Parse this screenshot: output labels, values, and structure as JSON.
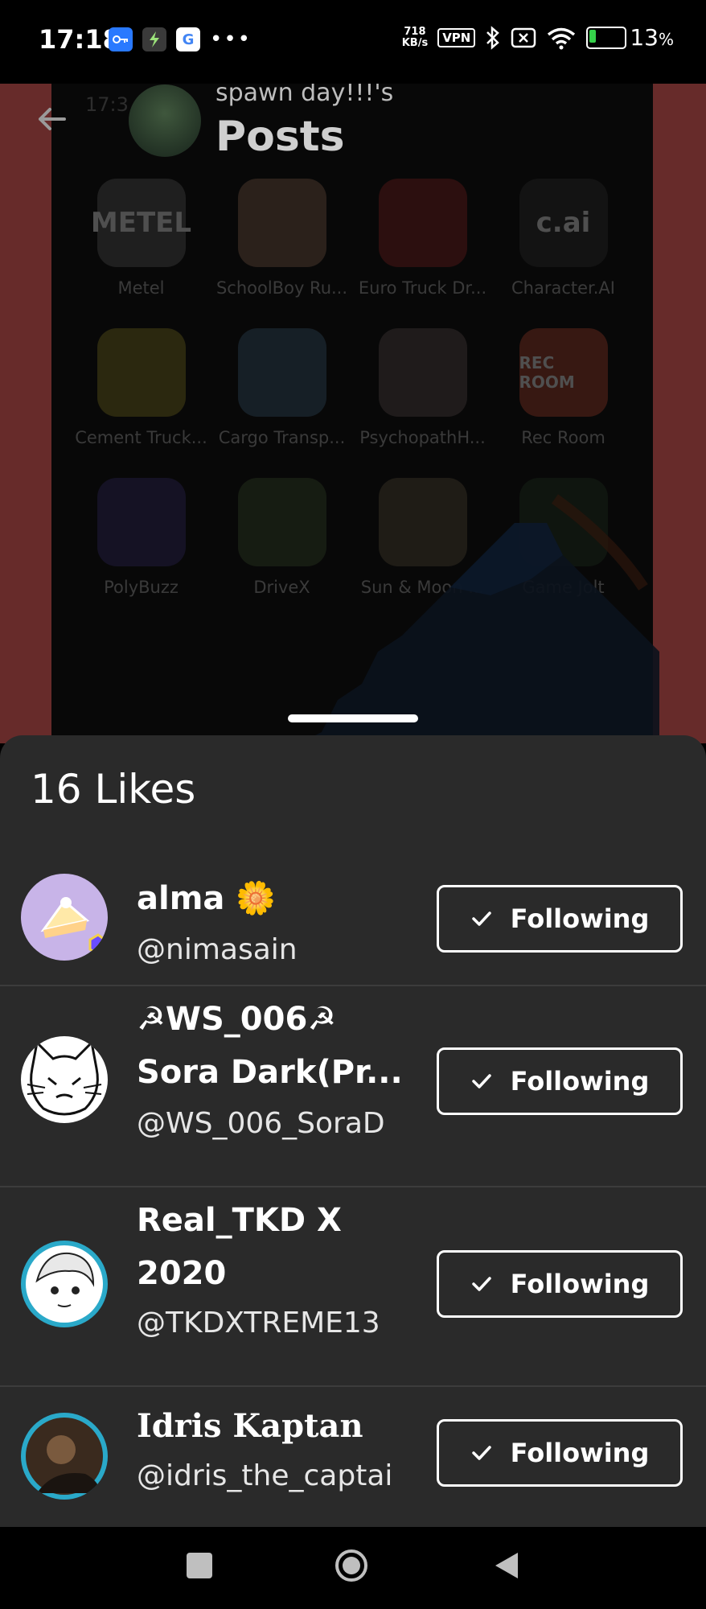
{
  "status_bar": {
    "time": "17:18",
    "net_speed_value": "718",
    "net_speed_unit": "KB/s",
    "vpn_label": "VPN",
    "battery_percent": "13",
    "battery_suffix": "%",
    "battery_level": 0.13,
    "left_icons": [
      "key-icon",
      "bolt-icon",
      "google-icon",
      "more-dots-icon"
    ],
    "right_icons": [
      "bluetooth-icon",
      "no-sim-icon",
      "wifi-icon",
      "battery-icon"
    ]
  },
  "background": {
    "faint_time": "17:3",
    "header": {
      "subtitle": "spawn day!!!'s",
      "title": "Posts"
    },
    "apps": [
      {
        "label": "Metel",
        "glyph": "METEL",
        "color": "#2a2a2a"
      },
      {
        "label": "SchoolBoy Ru...",
        "glyph": "",
        "color": "#3a2c24"
      },
      {
        "label": "Euro Truck Dr...",
        "glyph": "",
        "color": "#3b1414"
      },
      {
        "label": "Character.AI",
        "glyph": "c.ai",
        "color": "#1a1a1a"
      },
      {
        "label": "Cement Truck...",
        "glyph": "",
        "color": "#3a3614"
      },
      {
        "label": "Cargo Transp...",
        "glyph": "",
        "color": "#1e2a33"
      },
      {
        "label": "PsychopathH...",
        "glyph": "",
        "color": "#2a2424"
      },
      {
        "label": "Rec Room",
        "glyph": "REC ROOM",
        "color": "#4a2018"
      },
      {
        "label": "PolyBuzz",
        "glyph": "",
        "color": "#1c1830"
      },
      {
        "label": "DriveX",
        "glyph": "",
        "color": "#1e2618"
      },
      {
        "label": "Sun & Moon ...",
        "glyph": "",
        "color": "#2a261e"
      },
      {
        "label": "Game Jolt",
        "glyph": "",
        "color": "#141c14"
      }
    ]
  },
  "sheet": {
    "title": "16 Likes",
    "users": [
      {
        "name": "alma 🌼",
        "handle": "@nimasain",
        "button": "Following"
      },
      {
        "name": "☭WS_006☭ Sora Dark(Pr...",
        "handle": "@WS_006_SoraD",
        "button": "Following"
      },
      {
        "name": "Real_TKD X 2020",
        "handle": "@TKDXTREME13",
        "button": "Following"
      },
      {
        "name": "Idris Kaptan",
        "handle": "@idris_the_captai",
        "button": "Following"
      }
    ]
  },
  "nav": {
    "icons": [
      "recents-square-icon",
      "home-circle-icon",
      "back-triangle-icon"
    ]
  }
}
